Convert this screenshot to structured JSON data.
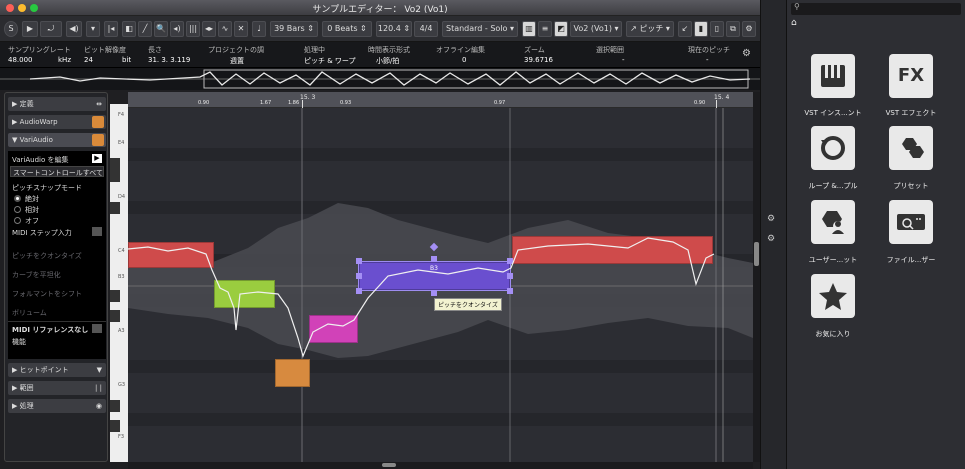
{
  "window": {
    "title": "サンプルエディター： Vo2 (Vo1)"
  },
  "toolbar": {
    "bars": "39 Bars",
    "beats": "0 Beats",
    "tempo": "120.4",
    "signature": "4/4",
    "mode": "Standard - Solo",
    "event": "Vo2 (Vo1)",
    "pitch_label": "ピッチ"
  },
  "info_headers": [
    "サンプリングレート",
    "ビット解像度",
    "長さ",
    "プロジェクトの調",
    "処理中",
    "時間表示形式",
    "オフライン編集",
    "ズーム",
    "選択範囲",
    "現在のピッチ"
  ],
  "info_values": [
    "48.000",
    "24",
    "31. 3. 3.119",
    "週置",
    "ピッチ & ワープ",
    "小節/拍",
    "0",
    "39.6716",
    "-",
    "-"
  ],
  "info_units": [
    "kHz",
    "bit"
  ],
  "ruler": {
    "marks": [
      "15. 3",
      "15. 4"
    ],
    "markers": [
      "0.90",
      "1.67",
      "1.86",
      "0.93",
      "0.97",
      "0.90"
    ]
  },
  "piano": {
    "notes": [
      "F4",
      "E4",
      "D4",
      "C4",
      "B3",
      "A3",
      "G3",
      "F3"
    ]
  },
  "inspector": {
    "sections": {
      "definition": "定義",
      "audiowarp": "AudioWarp",
      "variaudio": "VariAudio",
      "hitpoint": "ヒットポイント",
      "range": "範囲",
      "process": "処理"
    },
    "edit": "VariAudio を編集",
    "smart_control": "スマートコントロールすべて",
    "pitch_snap_mode": "ピッチスナップモード",
    "radios": [
      "絶対",
      "相対",
      "オフ"
    ],
    "midi_step": "MIDI ステップ入力",
    "commands": [
      "ピッチをクオンタイズ",
      "カーブを平坦化",
      "フォルマントをシフト",
      "ボリューム"
    ],
    "midi_reference": "MIDI リファレンスなし",
    "function": "機能"
  },
  "editor": {
    "note_label": "B3",
    "tooltip": "ピッチをクオンタイズ"
  },
  "right_panel": {
    "tiles": [
      {
        "label": "VST インス...ント",
        "icon": "piano-keys-icon"
      },
      {
        "label": "VST エフェクト",
        "icon": "fx-icon"
      },
      {
        "label": "ループ &...プル",
        "icon": "loop-icon"
      },
      {
        "label": "プリセット",
        "icon": "hexagon-icon"
      },
      {
        "label": "ユーザー...ット",
        "icon": "user-hexagon-icon"
      },
      {
        "label": "ファイル...ザー",
        "icon": "file-browser-icon"
      },
      {
        "label": "お気に入り",
        "icon": "star-icon"
      }
    ]
  }
}
